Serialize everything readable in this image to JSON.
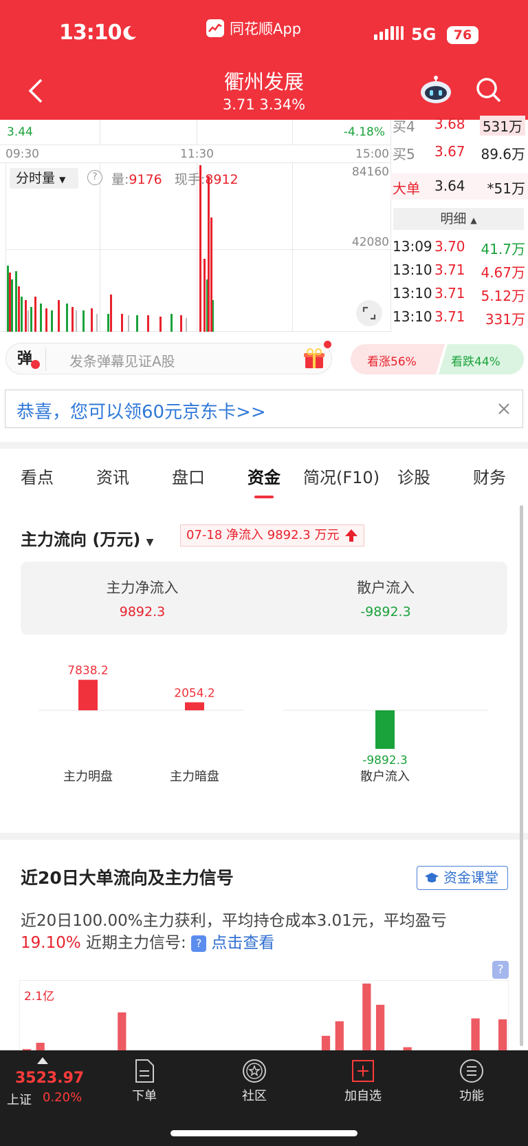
{
  "status": {
    "time": "13:10",
    "app": "同花顺App",
    "network": "5G",
    "battery": "76"
  },
  "header": {
    "stock_name": "衢州发展",
    "quote": "3.71 3.34%"
  },
  "chart": {
    "top_left": "3.44",
    "top_right": "-4.18%",
    "time_axis": [
      "09:30",
      "11:30",
      "15:00"
    ],
    "mode": "分时量",
    "volume_label": "量:",
    "volume_value": "9176",
    "hand_label": "现手:",
    "hand_value": "8912",
    "y_top": "84160",
    "y_mid": "42080"
  },
  "orderbook": {
    "rows": [
      {
        "label": "买4",
        "price": "3.68",
        "vol": "531万"
      },
      {
        "label": "买5",
        "price": "3.67",
        "vol": "89.6万"
      },
      {
        "label": "大单",
        "price": "3.64",
        "vol": "*51万"
      }
    ],
    "detail_label": "明细",
    "ticks": [
      {
        "time": "13:09",
        "price": "3.70",
        "vol": "41.7万",
        "vol_color": "#1aa23b"
      },
      {
        "time": "13:10",
        "price": "3.71",
        "vol": "4.67万",
        "vol_color": "#e8222d"
      },
      {
        "time": "13:10",
        "price": "3.71",
        "vol": "5.12万",
        "vol_color": "#e8222d"
      },
      {
        "time": "13:10",
        "price": "3.71",
        "vol": "331万",
        "vol_color": "#e8222d"
      }
    ]
  },
  "danmu": {
    "icon_text": "弹",
    "placeholder": "发条弹幕见证A股"
  },
  "vote": {
    "up": "看涨56%",
    "down": "看跌44%",
    "up_pct": 56
  },
  "promo": {
    "text": "恭喜，您可以领60元京东卡>>"
  },
  "tabs": [
    "看点",
    "资讯",
    "盘口",
    "资金",
    "简况(F10)",
    "诊股",
    "财务"
  ],
  "active_tab": "资金",
  "flow": {
    "title": "主力流向 (万元)",
    "badge": "07-18 净流入 9892.3 万元",
    "main_net_label": "主力净流入",
    "main_net_value": "9892.3",
    "retail_label": "散户流入",
    "retail_value": "-9892.3"
  },
  "chart_data": [
    {
      "type": "bar",
      "categories": [
        "主力明盘",
        "主力暗盘",
        "散户流入"
      ],
      "values": [
        7838.2,
        2054.2,
        -9892.3
      ],
      "value_labels": [
        "7838.2",
        "2054.2",
        "-9892.3"
      ],
      "colors": [
        "#f0323c",
        "#f0323c",
        "#1aa23b"
      ]
    },
    {
      "type": "bar",
      "y_label_top": "2.1亿",
      "values": [
        0.06,
        0.26,
        0,
        0,
        0,
        0,
        0,
        1.22,
        0,
        0,
        0,
        0,
        0,
        0,
        0,
        0,
        0,
        0,
        0,
        0,
        0,
        0,
        0.48,
        0.94,
        0,
        2.13,
        1.46,
        0,
        0.12,
        0,
        0,
        0,
        0,
        1.03,
        0,
        1.0
      ],
      "color": "#ee5a62"
    }
  ],
  "signal": {
    "title": "近20日大单流向及主力信号",
    "course_btn": "资金课堂",
    "desc1": "近20日100.00%主力获利，平均持仓成本3.01元，平均盈亏",
    "desc_pct": "19.10%",
    "desc2": " 近期主力信号:",
    "link": "点击查看"
  },
  "tabbar": {
    "index_value": "3523.97",
    "index_name": "上证",
    "index_pct": "0.20%",
    "items": [
      "下单",
      "社区",
      "加自选",
      "功能"
    ]
  }
}
